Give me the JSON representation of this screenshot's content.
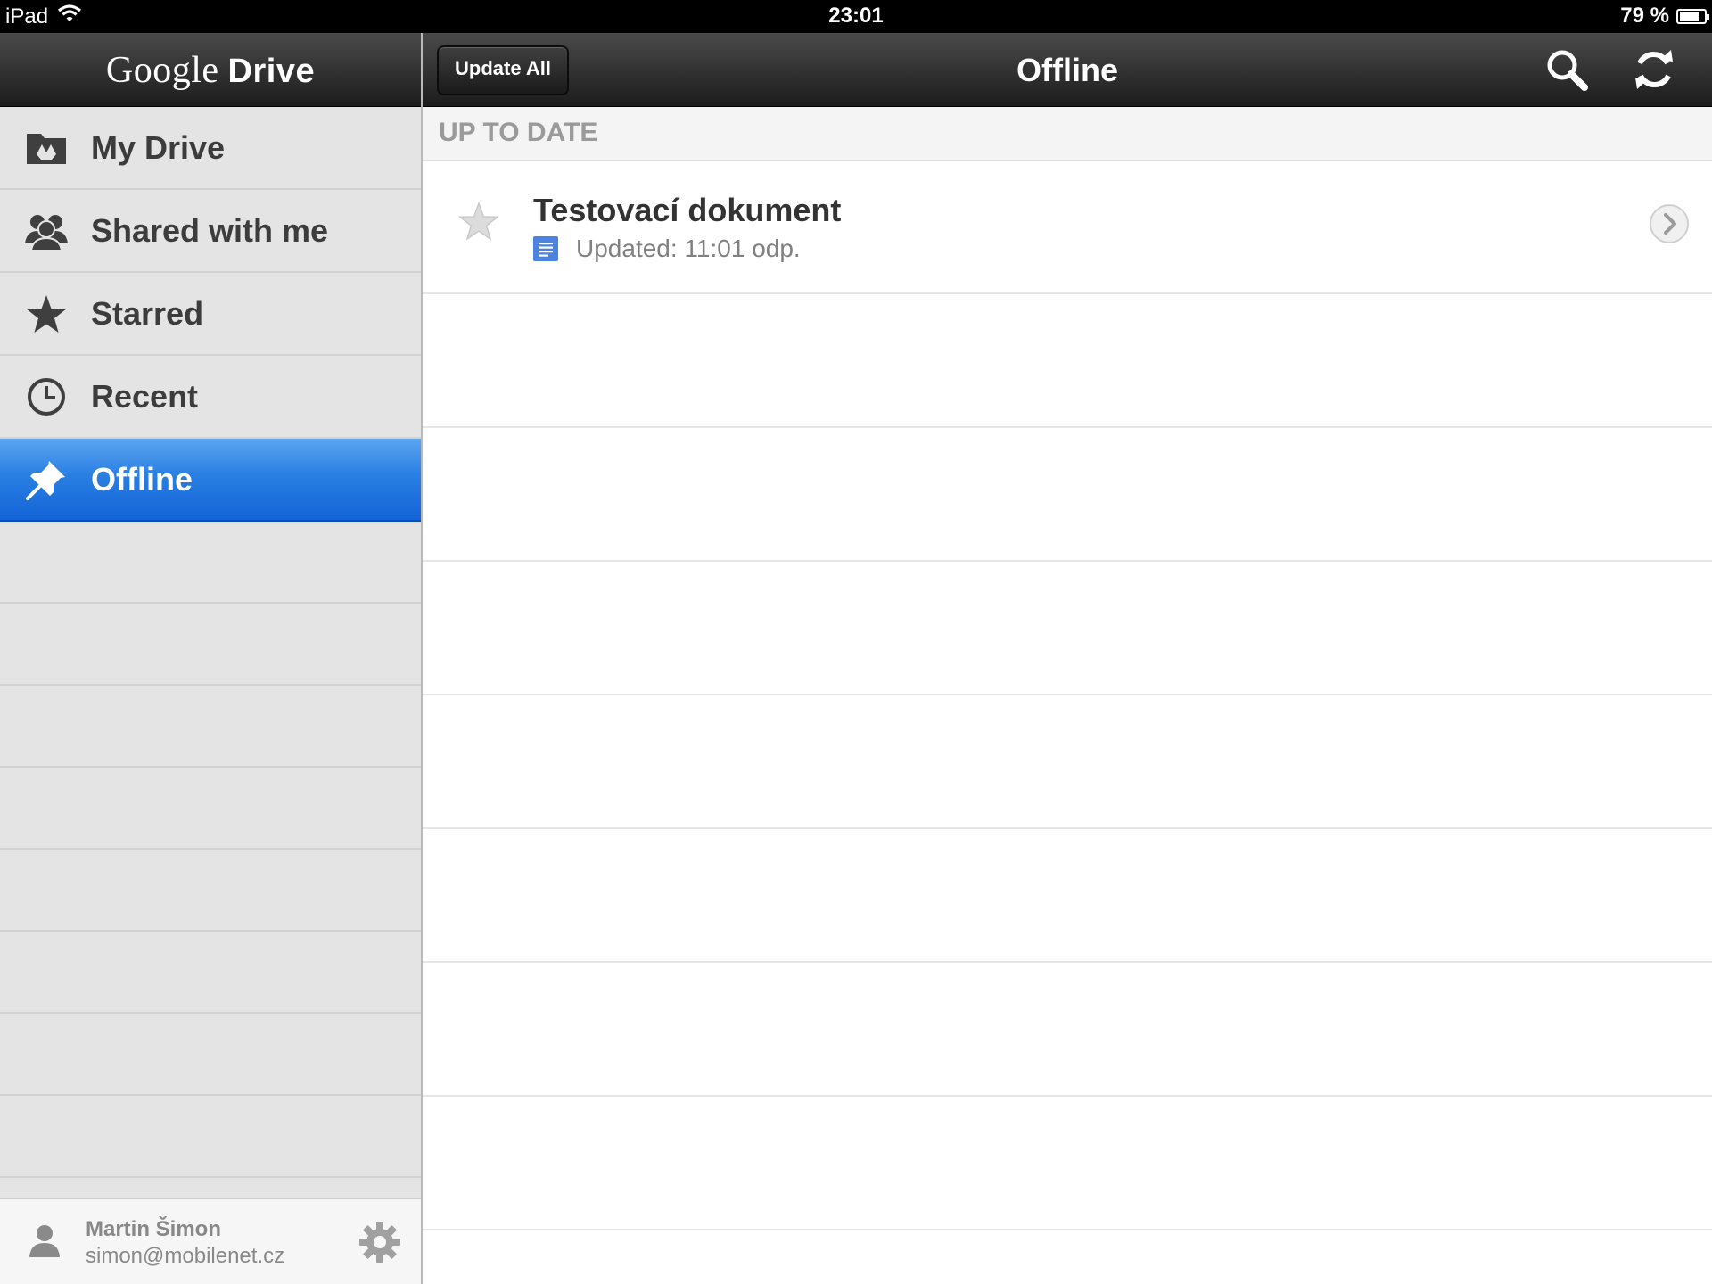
{
  "status_bar": {
    "device": "iPad",
    "time": "23:01",
    "battery": "79 %",
    "battery_level": 0.79
  },
  "sidebar": {
    "logo_google": "Google",
    "logo_drive": "Drive",
    "items": [
      {
        "label": "My Drive",
        "icon": "drive-folder-icon"
      },
      {
        "label": "Shared with me",
        "icon": "people-icon"
      },
      {
        "label": "Starred",
        "icon": "star-icon"
      },
      {
        "label": "Recent",
        "icon": "clock-icon"
      },
      {
        "label": "Offline",
        "icon": "pin-icon",
        "active": true
      }
    ],
    "footer": {
      "name": "Martin Šimon",
      "email": "simon@mobilenet.cz"
    }
  },
  "toolbar": {
    "update_all_label": "Update All",
    "title": "Offline"
  },
  "content": {
    "section_label": "UP TO DATE",
    "documents": [
      {
        "title": "Testovací dokument",
        "updated": "Updated: 11:01 odp.",
        "starred": false,
        "type_icon": "google-doc-icon"
      }
    ]
  },
  "colors": {
    "active_blue": "#1f74df",
    "doc_blue": "#4a84e0",
    "bar_dark": "#1c1c1c"
  }
}
